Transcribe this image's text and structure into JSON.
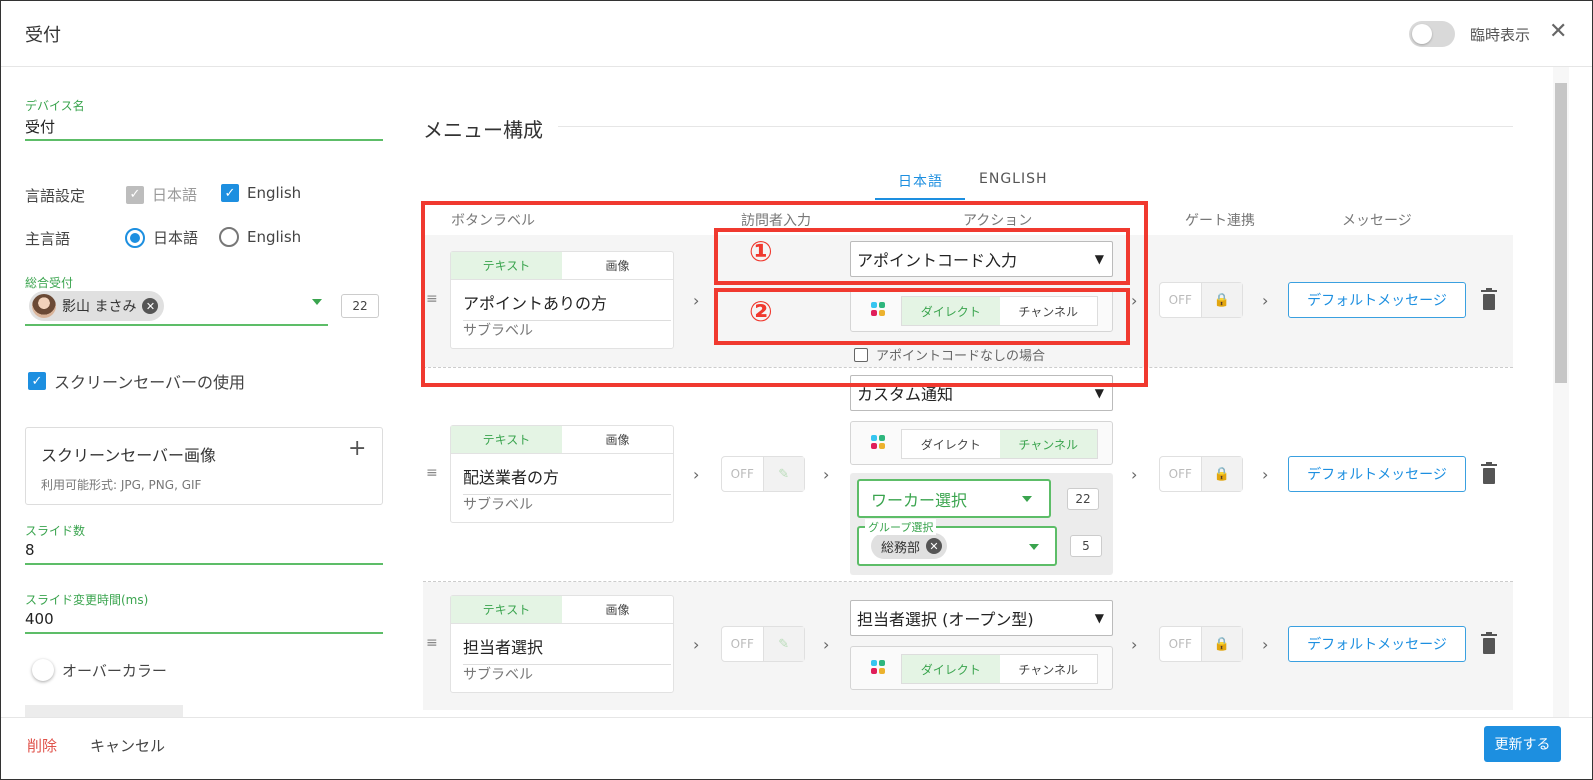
{
  "header": {
    "title": "受付",
    "toggle_label": "臨時表示"
  },
  "left": {
    "device_name_label": "デバイス名",
    "device_name_value": "受付",
    "lang_label": "言語設定",
    "lang_opt1": "日本語",
    "lang_opt2": "English",
    "main_lang_label": "主言語",
    "main_lang_opt1": "日本語",
    "main_lang_opt2": "English",
    "general_label": "総合受付",
    "general_chip": "影山 まさみ",
    "general_count": "22",
    "screensaver_use": "スクリーンセーバーの使用",
    "screensaver_image_title": "スクリーンセーバー画像",
    "screensaver_image_formats": "利用可能形式: JPG, PNG, GIF",
    "slide_count_label": "スライド数",
    "slide_count_value": "8",
    "slide_time_label": "スライド変更時間(ms)",
    "slide_time_value": "400",
    "over_color": "オーバーカラー"
  },
  "menu": {
    "title": "メニュー構成",
    "tabs": [
      "日本語",
      "ENGLISH"
    ],
    "columns": [
      "ボタンラベル",
      "訪問者入力",
      "アクション",
      "ゲート連携",
      "メッセージ"
    ],
    "seg_text": "テキスト",
    "seg_image": "画像",
    "sub_label": "サブラベル",
    "off": "OFF",
    "direct": "ダイレクト",
    "channel": "チャンネル",
    "default_message": "デフォルトメッセージ",
    "rows": [
      {
        "label": "アポイントありの方",
        "action": "アポイントコード入力",
        "no_code": "アポイントコードなしの場合"
      },
      {
        "label": "配送業者の方",
        "action": "カスタム通知",
        "worker_select": "ワーカー選択",
        "worker_count": "22",
        "group_legend": "グループ選択",
        "group_chip": "総務部",
        "group_count": "5"
      },
      {
        "label": "担当者選択",
        "action": "担当者選択 (オープン型)"
      }
    ]
  },
  "annotations": {
    "one": "①",
    "two": "②"
  },
  "footer": {
    "delete": "削除",
    "cancel": "キャンセル",
    "update": "更新する"
  },
  "colors": {
    "accent_green": "#3aa44e",
    "accent_blue": "#1d8fe0",
    "annotation_red": "#f0392f"
  }
}
